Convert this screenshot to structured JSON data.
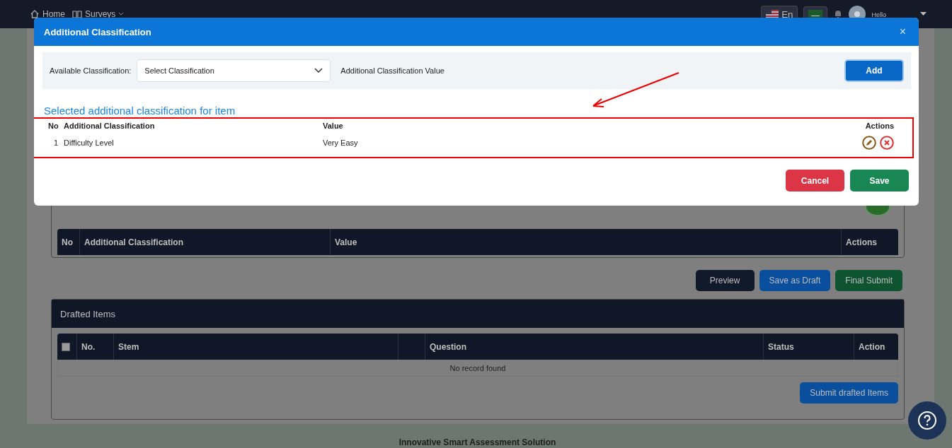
{
  "nav": {
    "items": [
      {
        "label": "Home",
        "kind": "home"
      },
      {
        "label": "Surveys",
        "kind": "menu"
      }
    ],
    "language": "En",
    "greeting": "Hello"
  },
  "page": {
    "classification_table": {
      "columns": [
        {
          "label": "No"
        },
        {
          "label": "Additional Classification"
        },
        {
          "label": "Value"
        },
        {
          "label": "Actions"
        }
      ]
    },
    "actions": [
      {
        "label": "Preview",
        "kind": "dark"
      },
      {
        "label": "Save as Draft",
        "kind": "primary"
      },
      {
        "label": "Final Submit",
        "kind": "success"
      }
    ],
    "drafted": {
      "title": "Drafted Items",
      "columns": [
        {
          "kind": "checkbox",
          "checked": false
        },
        {
          "kind": "text",
          "label": "No."
        },
        {
          "kind": "text",
          "label": "Stem"
        },
        {
          "kind": "blank"
        },
        {
          "kind": "text",
          "label": "Question"
        },
        {
          "kind": "text",
          "label": "Status"
        },
        {
          "kind": "text",
          "label": "Action"
        }
      ],
      "empty": "No record found",
      "submit": "Submit drafted Items"
    }
  },
  "modal": {
    "title": "Additional Classification",
    "close": "×",
    "available_label": "Available Classification:",
    "select_placeholder": "Select Classification",
    "value_label": "Additional Classification Value",
    "add": "Add",
    "heading": "Selected additional classification for item",
    "columns": [
      "No",
      "Additional Classification",
      "Value",
      "Actions"
    ],
    "rows": [
      {
        "no": "1",
        "classification": "Difficulty Level",
        "value": "Very Easy"
      }
    ],
    "buttons": [
      {
        "label": "Cancel",
        "kind": "danger"
      },
      {
        "label": "Save",
        "kind": "success"
      }
    ]
  },
  "footer": "Innovative Smart Assessment Solution"
}
